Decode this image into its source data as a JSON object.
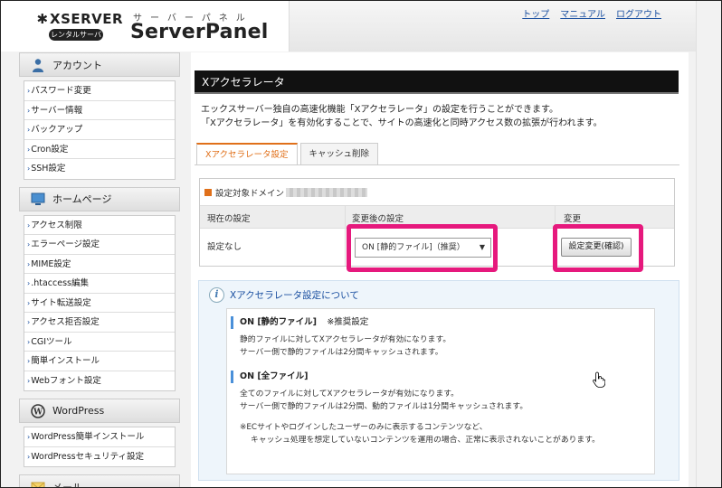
{
  "header": {
    "logo_text": "XSERVER",
    "logo_badge": "レンタルサーバー",
    "panel_kana": "サーバーパネル",
    "panel_title": "ServerPanel",
    "links": [
      "トップ",
      "マニュアル",
      "ログアウト"
    ]
  },
  "sidebar": {
    "sections": [
      {
        "title": "アカウント",
        "icon": "person-icon",
        "items": [
          "パスワード変更",
          "サーバー情報",
          "バックアップ",
          "Cron設定",
          "SSH設定"
        ]
      },
      {
        "title": "ホームページ",
        "icon": "monitor-icon",
        "items": [
          "アクセス制限",
          "エラーページ設定",
          "MIME設定",
          ".htaccess編集",
          "サイト転送設定",
          "アクセス拒否設定",
          "CGIツール",
          "簡単インストール",
          "Webフォント設定"
        ]
      },
      {
        "title": "WordPress",
        "icon": "wordpress-icon",
        "items": [
          "WordPress簡単インストール",
          "WordPressセキュリティ設定"
        ]
      },
      {
        "title": "メール",
        "icon": "envelope-icon",
        "items": []
      }
    ]
  },
  "main": {
    "title": "Xアクセラレータ",
    "description": [
      "エックスサーバー独自の高速化機能「Xアクセラレータ」の設定を行うことができます。",
      "「Xアクセラレータ」を有効化することで、サイトの高速化と同時アクセス数の拡張が行われます。"
    ],
    "tabs": [
      {
        "label": "Xアクセラレータ設定",
        "active": true
      },
      {
        "label": "キャッシュ削除",
        "active": false
      }
    ],
    "settings": {
      "domain_label": "設定対象ドメイン",
      "col_current": "現在の設定",
      "col_after": "変更後の設定",
      "col_change": "変更",
      "current_value": "設定なし",
      "select_value": "ON [静的ファイル]（推奨）",
      "confirm_button": "設定変更(確認)"
    },
    "info": {
      "title": "Xアクセラレータ設定について",
      "items": [
        {
          "heading": "ON [静的ファイル]",
          "note": "※推奨設定",
          "lines": [
            "静的ファイルに対してXアクセラレータが有効になります。",
            "サーバー側で静的ファイルは2分間キャッシュされます。"
          ]
        },
        {
          "heading": "ON [全ファイル]",
          "note": "",
          "lines": [
            "全てのファイルに対してXアクセラレータが有効になります。",
            "サーバー側で静的ファイルは2分間、動的ファイルは1分間キャッシュされます。"
          ]
        }
      ],
      "notes": [
        "※ECサイトやログインしたユーザーのみに表示するコンテンツなど、",
        "キャッシュ処理を想定していないコンテンツを運用の場合、正常に表示されないことがあります。"
      ]
    }
  },
  "colors": {
    "accent": "#e0701a",
    "highlight": "#e6197d",
    "link": "#1a4fa0"
  }
}
